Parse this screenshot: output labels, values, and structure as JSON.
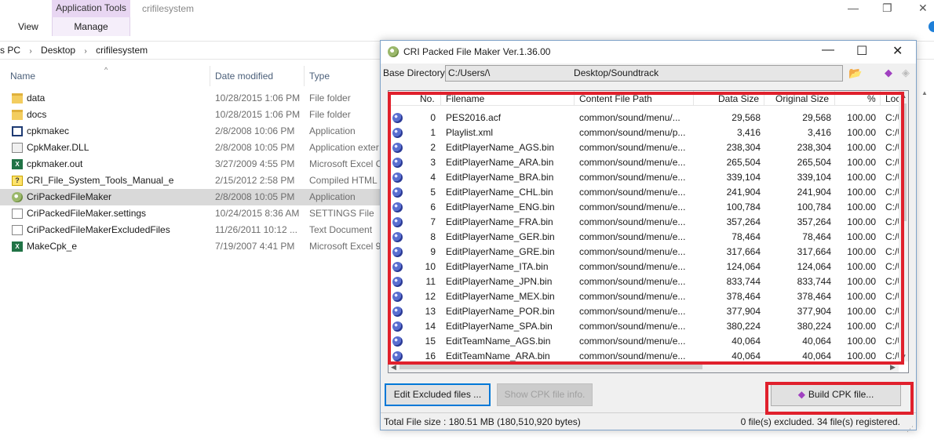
{
  "explorer": {
    "ribbon": {
      "context_tab": "Application Tools",
      "manage_tab": "Manage",
      "view_tab": "View",
      "folder_title": "crifilesystem"
    },
    "window_controls": {
      "minimize": "—",
      "restore": "❐",
      "close": "✕"
    },
    "address": {
      "crumbs": [
        "s PC",
        "Desktop",
        "crifilesystem"
      ],
      "separator": "›"
    },
    "columns": {
      "name": "Name",
      "date": "Date modified",
      "type": "Type"
    },
    "files": [
      {
        "icon": "folder-icon",
        "name": "data",
        "date": "10/28/2015 1:06 PM",
        "type": "File folder"
      },
      {
        "icon": "folder-icon",
        "name": "docs",
        "date": "10/28/2015 1:06 PM",
        "type": "File folder"
      },
      {
        "icon": "application-icon",
        "name": "cpkmakec",
        "date": "2/8/2008 10:06 PM",
        "type": "Application"
      },
      {
        "icon": "dll-icon",
        "name": "CpkMaker.DLL",
        "date": "2/8/2008 10:05 PM",
        "type": "Application exter"
      },
      {
        "icon": "excel-icon",
        "name": "cpkmaker.out",
        "date": "3/27/2009 4:55 PM",
        "type": "Microsoft Excel C"
      },
      {
        "icon": "chm-icon",
        "name": "CRI_File_System_Tools_Manual_e",
        "date": "2/15/2012 2:58 PM",
        "type": "Compiled HTML"
      },
      {
        "icon": "cri-app-icon",
        "name": "CriPackedFileMaker",
        "date": "2/8/2008 10:05 PM",
        "type": "Application",
        "selected": true
      },
      {
        "icon": "document-icon",
        "name": "CriPackedFileMaker.settings",
        "date": "10/24/2015 8:36 AM",
        "type": "SETTINGS File"
      },
      {
        "icon": "document-icon",
        "name": "CriPackedFileMakerExcludedFiles",
        "date": "11/26/2011 10:12 ...",
        "type": "Text Document"
      },
      {
        "icon": "excel-icon",
        "name": "MakeCpk_e",
        "date": "7/19/2007 4:41 PM",
        "type": "Microsoft Excel 9"
      }
    ]
  },
  "dialog": {
    "title": "CRI Packed File Maker Ver.1.36.00",
    "controls": {
      "minimize": "—",
      "maximize": "☐",
      "close": "✕"
    },
    "base_directory_label": "Base Directory",
    "base_directory_value": "C:/Users/\\                                Desktop/Soundtrack",
    "columns": {
      "no": "No.",
      "filename": "Filename",
      "content_path": "Content File Path",
      "data_size": "Data Size",
      "original_size": "Original Size",
      "percent": "%",
      "location": "Loc"
    },
    "rows": [
      {
        "no": "0",
        "filename": "PES2016.acf",
        "path": "common/sound/menu/...",
        "data_size": "29,568",
        "original_size": "29,568",
        "percent": "100.00",
        "loc": "C:/U"
      },
      {
        "no": "1",
        "filename": "Playlist.xml",
        "path": "common/sound/menu/p...",
        "data_size": "3,416",
        "original_size": "3,416",
        "percent": "100.00",
        "loc": "C:/U"
      },
      {
        "no": "2",
        "filename": "EditPlayerName_AGS.bin",
        "path": "common/sound/menu/e...",
        "data_size": "238,304",
        "original_size": "238,304",
        "percent": "100.00",
        "loc": "C:/U"
      },
      {
        "no": "3",
        "filename": "EditPlayerName_ARA.bin",
        "path": "common/sound/menu/e...",
        "data_size": "265,504",
        "original_size": "265,504",
        "percent": "100.00",
        "loc": "C:/U"
      },
      {
        "no": "4",
        "filename": "EditPlayerName_BRA.bin",
        "path": "common/sound/menu/e...",
        "data_size": "339,104",
        "original_size": "339,104",
        "percent": "100.00",
        "loc": "C:/U"
      },
      {
        "no": "5",
        "filename": "EditPlayerName_CHL.bin",
        "path": "common/sound/menu/e...",
        "data_size": "241,904",
        "original_size": "241,904",
        "percent": "100.00",
        "loc": "C:/U"
      },
      {
        "no": "6",
        "filename": "EditPlayerName_ENG.bin",
        "path": "common/sound/menu/e...",
        "data_size": "100,784",
        "original_size": "100,784",
        "percent": "100.00",
        "loc": "C:/U"
      },
      {
        "no": "7",
        "filename": "EditPlayerName_FRA.bin",
        "path": "common/sound/menu/e...",
        "data_size": "357,264",
        "original_size": "357,264",
        "percent": "100.00",
        "loc": "C:/U"
      },
      {
        "no": "8",
        "filename": "EditPlayerName_GER.bin",
        "path": "common/sound/menu/e...",
        "data_size": "78,464",
        "original_size": "78,464",
        "percent": "100.00",
        "loc": "C:/U"
      },
      {
        "no": "9",
        "filename": "EditPlayerName_GRE.bin",
        "path": "common/sound/menu/e...",
        "data_size": "317,664",
        "original_size": "317,664",
        "percent": "100.00",
        "loc": "C:/U"
      },
      {
        "no": "10",
        "filename": "EditPlayerName_ITA.bin",
        "path": "common/sound/menu/e...",
        "data_size": "124,064",
        "original_size": "124,064",
        "percent": "100.00",
        "loc": "C:/U"
      },
      {
        "no": "11",
        "filename": "EditPlayerName_JPN.bin",
        "path": "common/sound/menu/e...",
        "data_size": "833,744",
        "original_size": "833,744",
        "percent": "100.00",
        "loc": "C:/U"
      },
      {
        "no": "12",
        "filename": "EditPlayerName_MEX.bin",
        "path": "common/sound/menu/e...",
        "data_size": "378,464",
        "original_size": "378,464",
        "percent": "100.00",
        "loc": "C:/U"
      },
      {
        "no": "13",
        "filename": "EditPlayerName_POR.bin",
        "path": "common/sound/menu/e...",
        "data_size": "377,904",
        "original_size": "377,904",
        "percent": "100.00",
        "loc": "C:/U"
      },
      {
        "no": "14",
        "filename": "EditPlayerName_SPA.bin",
        "path": "common/sound/menu/e...",
        "data_size": "380,224",
        "original_size": "380,224",
        "percent": "100.00",
        "loc": "C:/U"
      },
      {
        "no": "15",
        "filename": "EditTeamName_AGS.bin",
        "path": "common/sound/menu/e...",
        "data_size": "40,064",
        "original_size": "40,064",
        "percent": "100.00",
        "loc": "C:/U"
      },
      {
        "no": "16",
        "filename": "EditTeamName_ARA.bin",
        "path": "common/sound/menu/e...",
        "data_size": "40,064",
        "original_size": "40,064",
        "percent": "100.00",
        "loc": "C:/U"
      }
    ],
    "buttons": {
      "edit_excluded": "Edit Excluded files ...",
      "show_cpk_info": "Show CPK file info.",
      "build_cpk": "Build CPK file..."
    },
    "status": {
      "total": "Total File size : 180.51 MB (180,510,920 bytes)",
      "counts": "0 file(s) excluded.  34 file(s) registered."
    },
    "colors": {
      "highlight": "#e0202c",
      "focus": "#0078d7"
    }
  }
}
